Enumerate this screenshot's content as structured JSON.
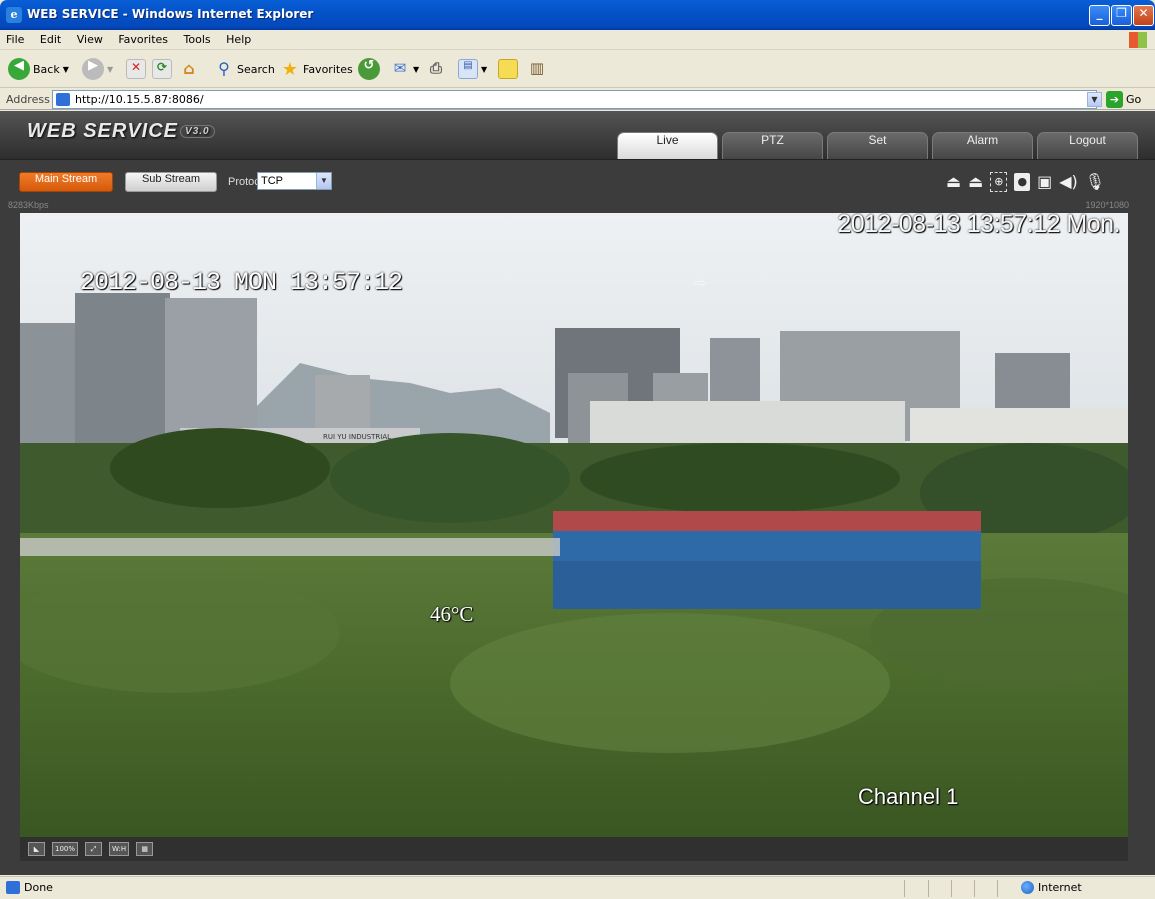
{
  "window": {
    "title": "WEB SERVICE - Windows Internet Explorer"
  },
  "menu": [
    "File",
    "Edit",
    "View",
    "Favorites",
    "Tools",
    "Help"
  ],
  "toolbar": {
    "back_label": "Back",
    "search_label": "Search",
    "favorites_label": "Favorites"
  },
  "address": {
    "label": "Address",
    "url": "http://10.15.5.87:8086/",
    "go_label": "Go"
  },
  "app": {
    "logo": "WEB SERVICE",
    "version": "V3.0",
    "tabs": [
      "Live",
      "PTZ",
      "Set",
      "Alarm",
      "Logout"
    ],
    "active_tab": "Live",
    "main_stream_label": "Main Stream",
    "sub_stream_label": "Sub Stream",
    "protocol_label": "Protocol",
    "protocol_value": "TCP",
    "bitrate": "8283Kbps",
    "resolution": "1920*1080"
  },
  "video": {
    "osd_date_right": "2012-08-13 13:57:12 Mon.",
    "osd_date_left": "2012-08-13 MON 13:57:12",
    "osd_temperature": "46°C",
    "osd_channel": "Channel 1",
    "osd_arrow": "⇨",
    "building_sign": "RUI YU INDUSTRIAL",
    "controls": [
      "100%",
      "W:H"
    ]
  },
  "status": {
    "left": "Done",
    "zone": "Internet"
  },
  "colors": {
    "accent_orange": "#e8711c",
    "ie_blue": "#0453c9",
    "app_dark": "#3c3c3c"
  }
}
